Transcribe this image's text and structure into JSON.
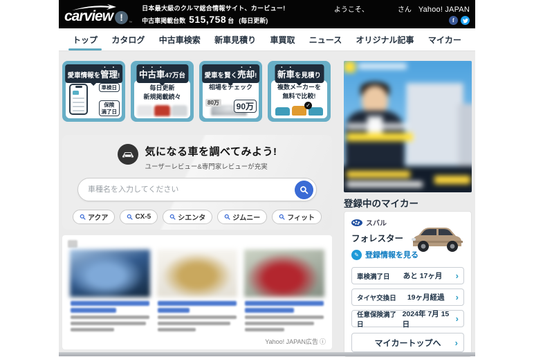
{
  "header": {
    "logo_text": "carview",
    "logo_mark": "!",
    "logo_tm": "™",
    "tagline": "日本最大級のクルマ総合情報サイト、カービュー!",
    "count_label": "中古車掲載台数",
    "count_value": "515,758",
    "count_unit": "台",
    "count_note": "(毎日更新)",
    "welcome_prefix": "ようこそ、",
    "welcome_suffix": "さん",
    "yahoo": "Yahoo! JAPAN"
  },
  "nav": {
    "tabs": [
      "トップ",
      "カタログ",
      "中古車検索",
      "新車見積り",
      "車買取",
      "ニュース",
      "オリジナル記事",
      "マイカー"
    ]
  },
  "promos": [
    {
      "pill_pre": "愛車情報を",
      "pill_emph": "管理",
      "pill_post": "!",
      "bubble1": "車検日",
      "bubble2_line1": "保険",
      "bubble2_line2": "満了日"
    },
    {
      "pill_pre": "",
      "pill_emph": "中古車",
      "pill_post": "47万台",
      "line1": "毎日更新",
      "line2": "新規掲載続々"
    },
    {
      "pill_pre": "愛車を賢く",
      "pill_emph": "売却",
      "pill_post": "!",
      "line1": "相場をチェック",
      "tag_low": "80万",
      "tag_high": "90万"
    },
    {
      "pill_pre": "",
      "pill_emph": "新車",
      "pill_post": "を見積り",
      "line1": "複数メーカーを",
      "line2": "無料で比較!"
    }
  ],
  "search": {
    "title": "気になる車を調べてみよう!",
    "subtitle": "ユーザーレビュー&専門家レビューが充実",
    "placeholder": "車種名を入力してください",
    "chips": [
      "アクア",
      "CX-5",
      "シエンタ",
      "ジムニー",
      "フィット"
    ]
  },
  "listing": {
    "ad_note": "Yahoo! JAPAN広告",
    "info_icon": "ⓘ"
  },
  "sidebar": {
    "mycar_heading": "登録中のマイカー",
    "mycar": {
      "brand": "スバル",
      "model": "フォレスター",
      "view_link": "登録情報を見る",
      "rows": [
        {
          "label": "車検満了日",
          "value": "あと 17ヶ月"
        },
        {
          "label": "タイヤ交換日",
          "value": "19ヶ月経過"
        },
        {
          "label": "任意保険満了日",
          "value": "2024年 7月 15日"
        }
      ],
      "button": "マイカートップへ"
    }
  },
  "icons": {
    "search": "magnifier",
    "pencil": "edit-pencil",
    "car": "car-front",
    "facebook": "facebook-f",
    "twitter": "twitter-bird",
    "chevron": "chevron-right",
    "info": "info-circle"
  },
  "colors": {
    "header_bg": "#050505",
    "accent_teal": "#68aec6",
    "tab_underline": "#5fa8bf",
    "pill_navy": "#1f2c3a",
    "search_button_blue": "#3a6bd5",
    "link_blue": "#0a7ac0",
    "chevron_teal": "#2f9ec4",
    "body_gray": "#ebebeb"
  }
}
